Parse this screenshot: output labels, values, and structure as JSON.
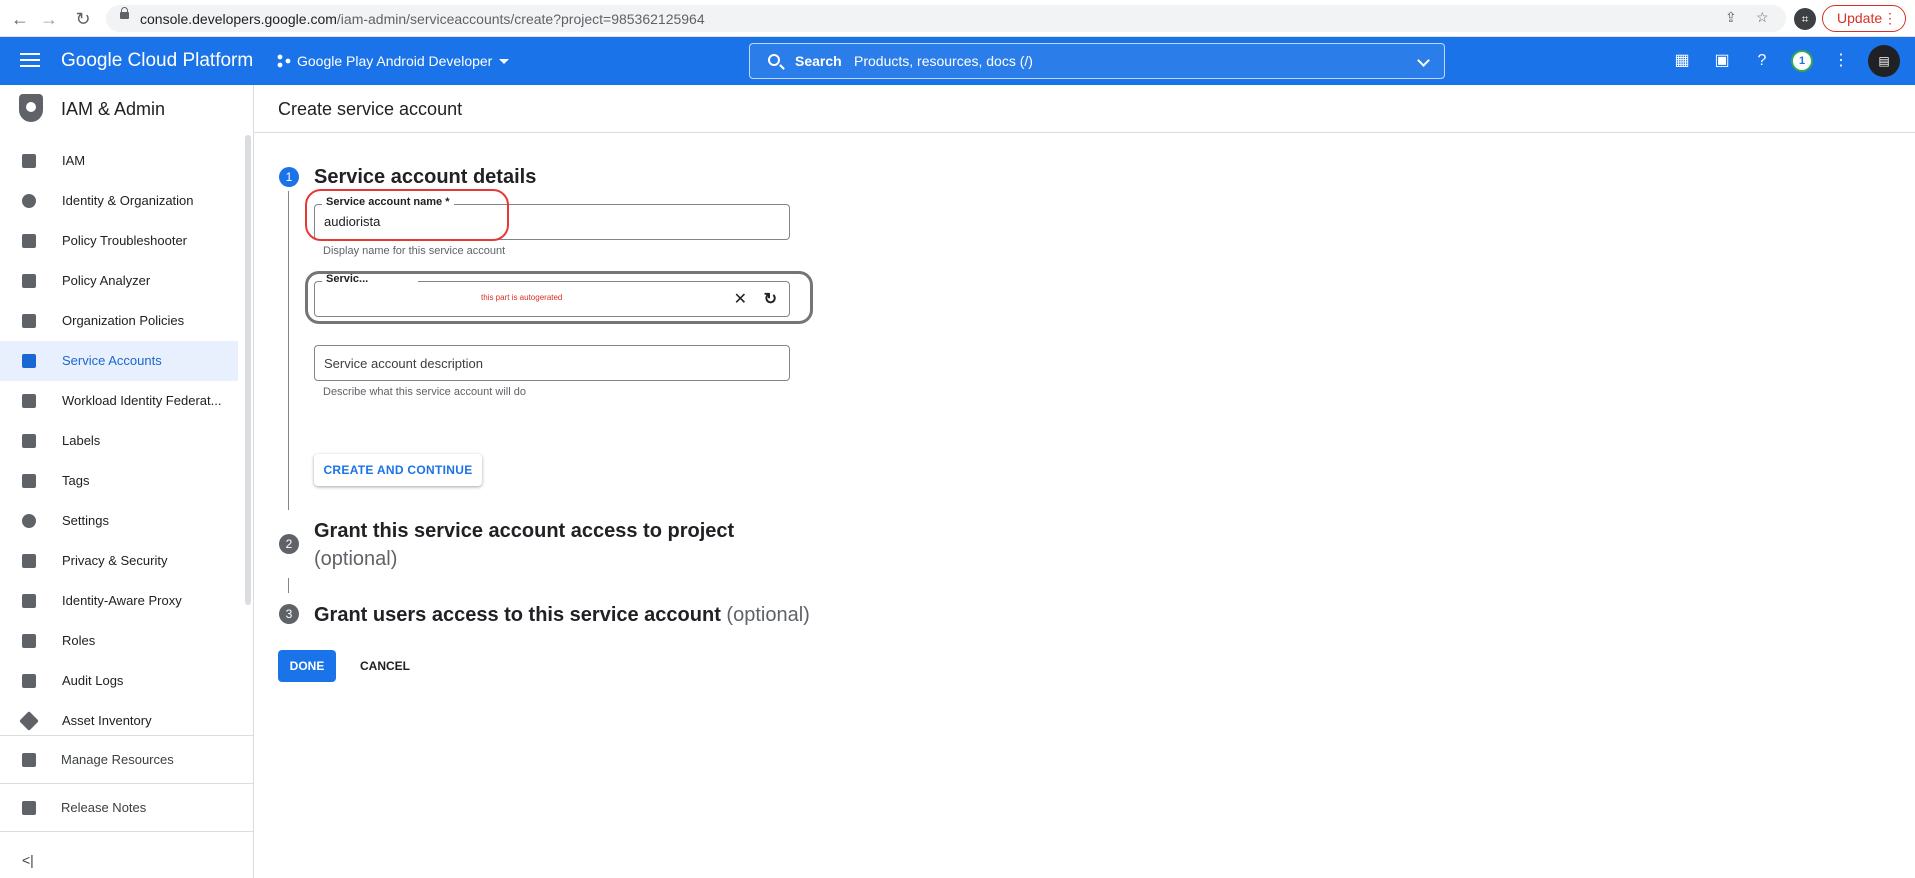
{
  "browser": {
    "url_host": "console.developers.google.com",
    "url_path": "/iam-admin/serviceaccounts/create?project=985362125964",
    "update_label": "Update"
  },
  "header": {
    "brand": "Google Cloud Platform",
    "project": "Google Play Android Developer",
    "search_label": "Search",
    "search_placeholder": "Products, resources, docs (/)",
    "notification_count": "1"
  },
  "sidebar": {
    "title": "IAM & Admin",
    "items": [
      {
        "label": "IAM",
        "icon": "person-add-icon"
      },
      {
        "label": "Identity & Organization",
        "icon": "account-circle-icon"
      },
      {
        "label": "Policy Troubleshooter",
        "icon": "wrench-icon"
      },
      {
        "label": "Policy Analyzer",
        "icon": "document-search-icon"
      },
      {
        "label": "Organization Policies",
        "icon": "list-document-icon"
      },
      {
        "label": "Service Accounts",
        "icon": "service-account-icon",
        "active": true
      },
      {
        "label": "Workload Identity Federat...",
        "icon": "id-card-icon"
      },
      {
        "label": "Labels",
        "icon": "label-icon"
      },
      {
        "label": "Tags",
        "icon": "tag-icon"
      },
      {
        "label": "Settings",
        "icon": "gear-icon"
      },
      {
        "label": "Privacy & Security",
        "icon": "shield-icon"
      },
      {
        "label": "Identity-Aware Proxy",
        "icon": "proxy-icon"
      },
      {
        "label": "Roles",
        "icon": "hat-icon"
      },
      {
        "label": "Audit Logs",
        "icon": "lines-icon"
      },
      {
        "label": "Asset Inventory",
        "icon": "diamond-icon"
      }
    ],
    "manage_resources": "Manage Resources",
    "release_notes": "Release Notes",
    "collapse_icon": "collapse-left-icon"
  },
  "main": {
    "page_title": "Create service account",
    "step1": {
      "number": "1",
      "title": "Service account details"
    },
    "name_field": {
      "label": "Service account name *",
      "value": "audiorista",
      "hint": "Display name for this service account"
    },
    "id_field": {
      "label": "Servic...",
      "annotation": "this part is autogerated"
    },
    "desc_field": {
      "placeholder": "Service account description",
      "hint": "Describe what this service account will do"
    },
    "create_button": "CREATE AND CONTINUE",
    "step2": {
      "number": "2",
      "title": "Grant this service account access to project",
      "optional": "(optional)"
    },
    "step3": {
      "number": "3",
      "title": "Grant users access to this service account",
      "optional": "(optional)"
    },
    "done_button": "DONE",
    "cancel_button": "CANCEL"
  },
  "colors": {
    "accent": "#1a73e8",
    "highlight": "#e53935",
    "annotation": "#d93025"
  }
}
